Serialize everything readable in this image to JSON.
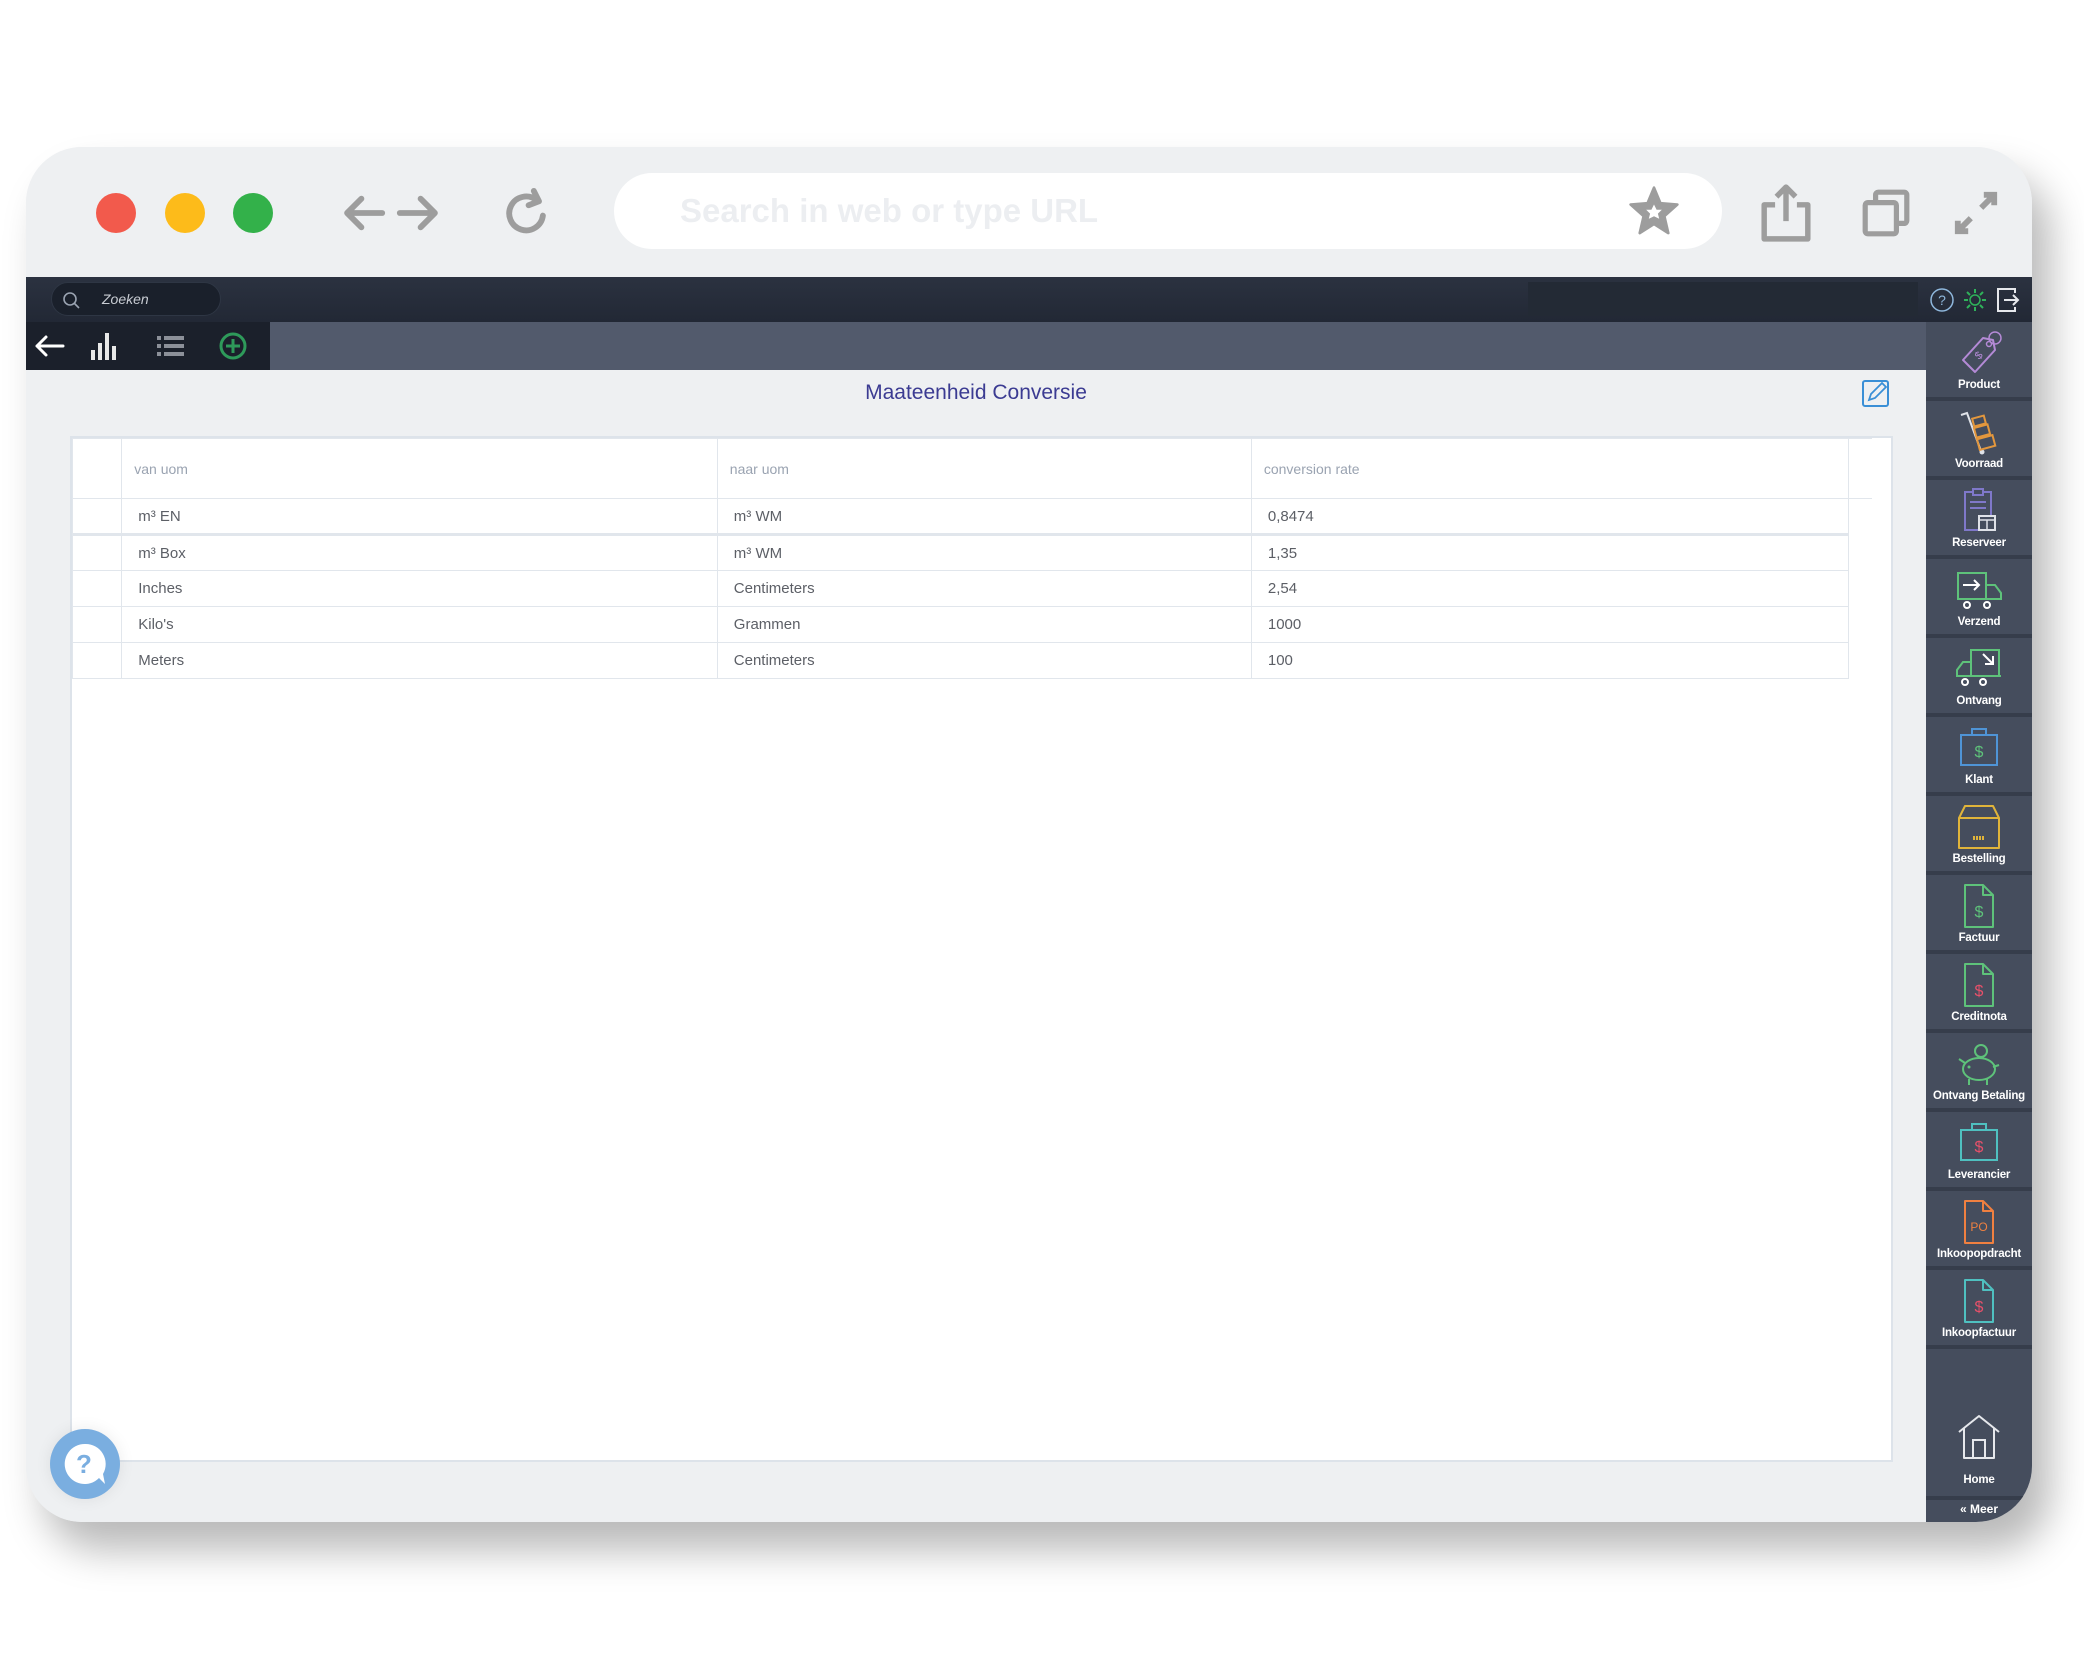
{
  "browser": {
    "url_placeholder": "Search in web or type URL",
    "traffic_lights": {
      "close": "#f25a4c",
      "minimize": "#fdbb1a",
      "maximize": "#33b14a"
    }
  },
  "topbar": {
    "search_placeholder": "Zoeken",
    "icons": [
      "help-icon",
      "settings-icon",
      "logout-icon"
    ]
  },
  "navbar": {
    "icons": [
      "back-arrow-icon",
      "bar-chart-icon",
      "list-icon",
      "add-circle-icon"
    ]
  },
  "page": {
    "title": "Maateenheid Conversie",
    "edit_icon": "edit-icon"
  },
  "table": {
    "columns": [
      "van uom",
      "naar uom",
      "conversion rate"
    ],
    "rows": [
      {
        "from": "m³ EN",
        "to": "m³ WM",
        "rate": "0,8474"
      },
      {
        "from": "m³ Box",
        "to": "m³ WM",
        "rate": "1,35"
      },
      {
        "from": "Inches",
        "to": "Centimeters",
        "rate": "2,54"
      },
      {
        "from": "Kilo's",
        "to": "Grammen",
        "rate": "1000"
      },
      {
        "from": "Meters",
        "to": "Centimeters",
        "rate": "100"
      }
    ]
  },
  "sidebar": {
    "items": [
      {
        "label": "Product",
        "icon": "price-tag-icon",
        "color": "#b48ad6"
      },
      {
        "label": "Voorraad",
        "icon": "hand-truck-icon",
        "color": "#e3973d"
      },
      {
        "label": "Reserveer",
        "icon": "clipboard-box-icon",
        "color": "#7f78c9"
      },
      {
        "label": "Verzend",
        "icon": "shipping-truck-icon",
        "color": "#5ec27a"
      },
      {
        "label": "Ontvang",
        "icon": "receiving-truck-icon",
        "color": "#5ec27a"
      },
      {
        "label": "Klant",
        "icon": "customer-briefcase-icon",
        "color": "#4f94d6"
      },
      {
        "label": "Bestelling",
        "icon": "order-box-icon",
        "color": "#e0b43a"
      },
      {
        "label": "Factuur",
        "icon": "invoice-icon",
        "color": "#5ec27a"
      },
      {
        "label": "Creditnota",
        "icon": "credit-note-icon",
        "color": "#5ec27a"
      },
      {
        "label": "Ontvang Betaling",
        "icon": "piggy-bank-icon",
        "color": "#5ec27a"
      },
      {
        "label": "Leverancier",
        "icon": "supplier-briefcase-icon",
        "color": "#4fc0c0"
      },
      {
        "label": "Inkoopopdracht",
        "icon": "purchase-order-icon",
        "color": "#f08040"
      },
      {
        "label": "Inkoopfactuur",
        "icon": "purchase-invoice-icon",
        "color": "#4fc0c0"
      }
    ],
    "home_label": "Home",
    "more_label": "« Meer"
  },
  "help_fab": {
    "icon": "help-chat-icon",
    "color": "#7aaee0"
  }
}
